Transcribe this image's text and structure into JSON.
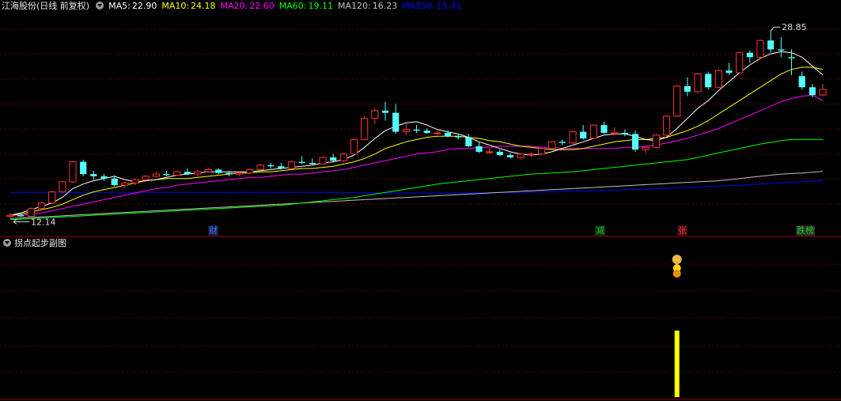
{
  "header": {
    "title": "江海股份(日线 前复权)",
    "ma": [
      {
        "label": "MA5:",
        "value": "22.90",
        "color": "#ffffff"
      },
      {
        "label": "MA10:",
        "value": "24.18",
        "color": "#ffff00"
      },
      {
        "label": "MA20:",
        "value": "22.60",
        "color": "#ff00ff"
      },
      {
        "label": "MA60:",
        "value": "19.11",
        "color": "#00ff00"
      },
      {
        "label": "MA120:",
        "value": "16.23",
        "color": "#c0c0c0"
      },
      {
        "label": "MA250:",
        "value": "15.41",
        "color": "#0000ff"
      }
    ]
  },
  "annotations": {
    "high": "28.85",
    "low": "12.14"
  },
  "event_tags": [
    {
      "label": "财",
      "color": "#3b7ff5",
      "bg": "#1a1a40"
    },
    {
      "label": "减",
      "color": "#22cc22",
      "bg": "#0f2a0f"
    },
    {
      "label": "张",
      "color": "#ff3333",
      "bg": "#3a0f0f"
    },
    {
      "label": "跌榜",
      "color": "#22cc22",
      "bg": "#2a2a2a"
    }
  ],
  "subchart": {
    "title": "拐点起步副图",
    "signal_color": "#ffff00"
  },
  "chart_data": {
    "type": "candlestick",
    "colors": {
      "up": "#ff3333",
      "down": "#54ffff",
      "ma5": "#ffffff",
      "ma10": "#ffff00",
      "ma20": "#ff00ff",
      "ma60": "#00ff00",
      "ma120": "#c0c0c0",
      "ma250": "#0000ff"
    },
    "ylim": [
      11.6,
      30.5
    ],
    "candles": [
      [
        12.2,
        12.5,
        12.0,
        12.3
      ],
      [
        12.3,
        12.4,
        12.14,
        12.2
      ],
      [
        12.2,
        13.0,
        12.2,
        12.9
      ],
      [
        12.9,
        13.5,
        12.8,
        13.4
      ],
      [
        13.4,
        14.5,
        13.3,
        14.4
      ],
      [
        14.4,
        15.4,
        14.3,
        15.3
      ],
      [
        15.3,
        17.2,
        15.2,
        17.1
      ],
      [
        17.1,
        17.3,
        15.8,
        16.0
      ],
      [
        16.0,
        16.3,
        15.5,
        15.8
      ],
      [
        15.8,
        16.0,
        15.4,
        15.6
      ],
      [
        15.6,
        15.9,
        14.9,
        15.0
      ],
      [
        15.0,
        15.3,
        14.7,
        15.2
      ],
      [
        15.2,
        15.6,
        15.0,
        15.5
      ],
      [
        15.5,
        15.9,
        15.4,
        15.8
      ],
      [
        15.8,
        16.2,
        15.7,
        16.0
      ],
      [
        16.0,
        16.3,
        15.8,
        15.9
      ],
      [
        15.9,
        16.3,
        15.8,
        16.2
      ],
      [
        16.2,
        16.5,
        15.9,
        16.0
      ],
      [
        16.0,
        16.4,
        15.8,
        16.2
      ],
      [
        16.2,
        16.6,
        16.1,
        16.4
      ],
      [
        16.4,
        16.5,
        16.0,
        16.1
      ],
      [
        16.1,
        16.3,
        15.8,
        16.0
      ],
      [
        16.0,
        16.2,
        15.8,
        16.1
      ],
      [
        16.1,
        16.5,
        16.0,
        16.4
      ],
      [
        16.4,
        16.9,
        16.3,
        16.8
      ],
      [
        16.8,
        17.0,
        16.5,
        16.7
      ],
      [
        16.7,
        17.0,
        16.4,
        16.5
      ],
      [
        16.5,
        17.2,
        16.5,
        17.1
      ],
      [
        17.1,
        17.6,
        16.9,
        17.0
      ],
      [
        17.0,
        17.4,
        16.8,
        16.9
      ],
      [
        16.9,
        17.6,
        16.9,
        17.5
      ],
      [
        17.5,
        17.8,
        17.1,
        17.2
      ],
      [
        17.2,
        17.9,
        17.1,
        17.8
      ],
      [
        17.8,
        19.2,
        17.8,
        19.1
      ],
      [
        19.1,
        21.2,
        19.0,
        21.0
      ],
      [
        21.0,
        21.9,
        20.5,
        21.7
      ],
      [
        21.7,
        22.5,
        20.8,
        21.5
      ],
      [
        21.5,
        22.3,
        19.6,
        19.8
      ],
      [
        19.8,
        20.5,
        19.5,
        20.0
      ],
      [
        20.0,
        20.4,
        19.7,
        19.9
      ],
      [
        19.9,
        20.1,
        19.6,
        19.7
      ],
      [
        19.7,
        19.9,
        19.5,
        19.7
      ],
      [
        19.7,
        19.9,
        19.3,
        19.4
      ],
      [
        19.4,
        19.6,
        19.1,
        19.3
      ],
      [
        19.3,
        19.6,
        18.4,
        18.5
      ],
      [
        18.5,
        18.9,
        17.9,
        18.0
      ],
      [
        18.0,
        18.3,
        17.8,
        18.0
      ],
      [
        18.0,
        18.2,
        17.6,
        17.7
      ],
      [
        17.7,
        17.9,
        17.4,
        17.5
      ],
      [
        17.5,
        17.9,
        17.3,
        17.8
      ],
      [
        17.8,
        18.0,
        17.5,
        17.8
      ],
      [
        17.8,
        18.4,
        17.7,
        18.3
      ],
      [
        18.3,
        19.0,
        18.2,
        18.9
      ],
      [
        18.9,
        19.1,
        18.6,
        18.8
      ],
      [
        18.8,
        19.9,
        18.7,
        19.8
      ],
      [
        19.8,
        20.4,
        19.1,
        19.2
      ],
      [
        19.2,
        20.5,
        19.1,
        20.4
      ],
      [
        20.4,
        20.7,
        19.6,
        19.7
      ],
      [
        19.7,
        20.2,
        19.5,
        19.7
      ],
      [
        19.7,
        20.0,
        19.4,
        19.6
      ],
      [
        19.6,
        19.9,
        18.0,
        18.2
      ],
      [
        18.2,
        18.5,
        17.9,
        18.4
      ],
      [
        18.4,
        19.6,
        18.3,
        19.5
      ],
      [
        19.5,
        21.3,
        19.4,
        21.2
      ],
      [
        21.2,
        24.0,
        21.1,
        23.9
      ],
      [
        23.9,
        24.7,
        23.0,
        23.4
      ],
      [
        23.4,
        25.1,
        23.3,
        25.0
      ],
      [
        25.0,
        25.2,
        23.6,
        23.8
      ],
      [
        23.8,
        25.4,
        23.7,
        25.3
      ],
      [
        25.3,
        26.0,
        24.9,
        25.1
      ],
      [
        25.1,
        27.0,
        25.0,
        26.9
      ],
      [
        26.9,
        27.1,
        26.0,
        26.5
      ],
      [
        26.5,
        28.1,
        26.3,
        28.0
      ],
      [
        28.0,
        28.85,
        26.9,
        27.2
      ],
      [
        27.2,
        28.3,
        26.5,
        27.1
      ],
      [
        26.5,
        27.2,
        24.9,
        26.4
      ],
      [
        24.8,
        25.2,
        23.6,
        23.8
      ],
      [
        23.8,
        24.1,
        22.9,
        23.1
      ],
      [
        23.1,
        24.1,
        23.0,
        23.6
      ]
    ],
    "ma5": [
      12.3,
      12.5,
      12.8,
      13.1,
      13.4,
      13.9,
      14.7,
      15.1,
      15.4,
      15.6,
      15.8,
      15.5,
      15.3,
      15.4,
      15.5,
      15.7,
      15.9,
      16.0,
      16.1,
      16.2,
      16.2,
      16.2,
      16.2,
      16.2,
      16.3,
      16.4,
      16.5,
      16.6,
      16.7,
      16.8,
      17.0,
      17.1,
      17.3,
      17.7,
      18.4,
      19.2,
      19.9,
      20.3,
      20.6,
      20.7,
      20.4,
      20.0,
      19.8,
      19.6,
      19.3,
      18.9,
      18.6,
      18.3,
      18.0,
      17.8,
      17.7,
      17.8,
      18.0,
      18.3,
      18.6,
      18.9,
      19.2,
      19.5,
      19.6,
      19.6,
      19.4,
      19.1,
      19.0,
      19.3,
      20.1,
      21.0,
      21.9,
      22.6,
      23.5,
      24.3,
      25.1,
      25.8,
      26.4,
      26.8,
      27.0,
      26.9,
      26.5,
      25.7,
      24.9
    ],
    "ma10": [
      12.3,
      12.4,
      12.6,
      12.8,
      13.0,
      13.3,
      13.7,
      14.1,
      14.4,
      14.6,
      14.8,
      15.0,
      15.2,
      15.4,
      15.5,
      15.6,
      15.6,
      15.6,
      15.7,
      15.8,
      15.9,
      16.0,
      16.1,
      16.1,
      16.2,
      16.2,
      16.3,
      16.4,
      16.5,
      16.5,
      16.6,
      16.7,
      16.9,
      17.1,
      17.4,
      17.8,
      18.3,
      18.6,
      18.9,
      19.1,
      19.3,
      19.4,
      19.4,
      19.4,
      19.3,
      19.2,
      19.0,
      18.9,
      18.7,
      18.5,
      18.4,
      18.3,
      18.2,
      18.2,
      18.2,
      18.3,
      18.5,
      18.7,
      18.9,
      19.0,
      19.1,
      19.1,
      19.2,
      19.3,
      19.6,
      19.9,
      20.3,
      20.8,
      21.4,
      22.0,
      22.6,
      23.2,
      23.8,
      24.4,
      25.0,
      25.4,
      25.6,
      25.6,
      25.4
    ],
    "ma20": [
      12.3,
      12.3,
      12.4,
      12.5,
      12.7,
      12.9,
      13.1,
      13.3,
      13.5,
      13.7,
      13.9,
      14.1,
      14.3,
      14.5,
      14.7,
      14.8,
      15.0,
      15.1,
      15.2,
      15.3,
      15.4,
      15.5,
      15.6,
      15.7,
      15.7,
      15.8,
      15.9,
      16.0,
      16.0,
      16.1,
      16.2,
      16.3,
      16.4,
      16.6,
      16.8,
      17.0,
      17.2,
      17.4,
      17.6,
      17.8,
      17.9,
      18.0,
      18.2,
      18.3,
      18.3,
      18.4,
      18.4,
      18.5,
      18.5,
      18.5,
      18.5,
      18.4,
      18.4,
      18.3,
      18.3,
      18.3,
      18.3,
      18.3,
      18.3,
      18.4,
      18.4,
      18.5,
      18.6,
      18.8,
      19.0,
      19.2,
      19.5,
      19.8,
      20.1,
      20.5,
      20.9,
      21.3,
      21.7,
      22.1,
      22.5,
      22.8,
      23.0,
      23.1,
      22.6
    ],
    "ma60": [
      11.9,
      11.95,
      12.0,
      12.05,
      12.1,
      12.15,
      12.2,
      12.25,
      12.3,
      12.35,
      12.4,
      12.45,
      12.5,
      12.55,
      12.6,
      12.65,
      12.7,
      12.75,
      12.8,
      12.85,
      12.9,
      12.95,
      13.0,
      13.05,
      13.1,
      13.15,
      13.2,
      13.3,
      13.4,
      13.5,
      13.6,
      13.7,
      13.8,
      13.9,
      14.05,
      14.2,
      14.35,
      14.5,
      14.65,
      14.8,
      14.95,
      15.1,
      15.2,
      15.3,
      15.4,
      15.5,
      15.6,
      15.7,
      15.8,
      15.9,
      16.0,
      16.05,
      16.1,
      16.15,
      16.2,
      16.3,
      16.4,
      16.5,
      16.6,
      16.7,
      16.8,
      16.9,
      17.0,
      17.1,
      17.2,
      17.3,
      17.5,
      17.7,
      17.9,
      18.1,
      18.3,
      18.5,
      18.7,
      18.85,
      19.0,
      19.1,
      19.11,
      19.11,
      19.11
    ],
    "ma120": [
      12.0,
      12.05,
      12.1,
      12.15,
      12.2,
      12.25,
      12.3,
      12.35,
      12.4,
      12.45,
      12.5,
      12.55,
      12.6,
      12.65,
      12.7,
      12.75,
      12.8,
      12.85,
      12.9,
      12.95,
      13.0,
      13.05,
      13.1,
      13.15,
      13.2,
      13.25,
      13.3,
      13.35,
      13.4,
      13.45,
      13.5,
      13.55,
      13.6,
      13.65,
      13.7,
      13.75,
      13.8,
      13.85,
      13.9,
      13.95,
      14.0,
      14.05,
      14.1,
      14.15,
      14.2,
      14.25,
      14.3,
      14.35,
      14.4,
      14.45,
      14.5,
      14.55,
      14.6,
      14.65,
      14.7,
      14.75,
      14.8,
      14.85,
      14.9,
      14.95,
      15.0,
      15.05,
      15.1,
      15.15,
      15.2,
      15.25,
      15.3,
      15.35,
      15.4,
      15.5,
      15.6,
      15.7,
      15.8,
      15.9,
      16.0,
      16.05,
      16.1,
      16.17,
      16.23
    ],
    "ma250": [
      14.35,
      14.35,
      14.35,
      14.35,
      14.35,
      14.35,
      14.35,
      14.35,
      14.35,
      14.35,
      14.35,
      14.35,
      14.35,
      14.35,
      14.35,
      14.35,
      14.35,
      14.35,
      14.35,
      14.35,
      14.35,
      14.35,
      14.35,
      14.35,
      14.35,
      14.35,
      14.35,
      14.35,
      14.35,
      14.35,
      14.35,
      14.35,
      14.35,
      14.33,
      14.32,
      14.31,
      14.3,
      14.3,
      14.3,
      14.3,
      14.3,
      14.3,
      14.3,
      14.3,
      14.31,
      14.32,
      14.33,
      14.34,
      14.35,
      14.36,
      14.38,
      14.4,
      14.42,
      14.44,
      14.46,
      14.48,
      14.5,
      14.53,
      14.56,
      14.59,
      14.62,
      14.65,
      14.68,
      14.72,
      14.76,
      14.8,
      14.84,
      14.88,
      14.92,
      14.96,
      15.0,
      15.05,
      15.1,
      15.15,
      15.2,
      15.25,
      15.3,
      15.36,
      15.41
    ],
    "signal_index": 64
  }
}
